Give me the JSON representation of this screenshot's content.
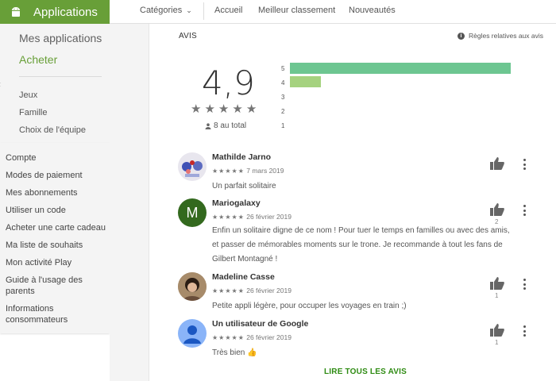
{
  "sidebar": {
    "app_title": "Applications",
    "my_apps": "Mes applications",
    "buy": "Acheter",
    "categories": [
      "Jeux",
      "Famille",
      "Choix de l'équipe"
    ],
    "account_links": [
      "Compte",
      "Modes de paiement",
      "Mes abonnements",
      "Utiliser un code",
      "Acheter une carte cadeau",
      "Ma liste de souhaits",
      "Mon activité Play",
      "Guide à l'usage des parents",
      "Informations consommateurs"
    ]
  },
  "topnav": {
    "categories": "Catégories",
    "home": "Accueil",
    "top": "Meilleur classement",
    "new": "Nouveautés"
  },
  "reviews_section": {
    "title": "AVIS",
    "rules": "Règles relatives aux avis",
    "score": "4,9",
    "total": "8 au total",
    "histogram": [
      {
        "label": "5",
        "fraction": 1.0,
        "color": "#6dc691"
      },
      {
        "label": "4",
        "fraction": 0.14,
        "color": "#a5d27f"
      },
      {
        "label": "3",
        "fraction": 0
      },
      {
        "label": "2",
        "fraction": 0
      },
      {
        "label": "1",
        "fraction": 0
      }
    ],
    "read_all": "LIRE TOUS LES AVIS"
  },
  "reviews": [
    {
      "name": "Mathilde Jarno",
      "date": "7 mars 2019",
      "text": "Un parfait solitaire",
      "likes": "",
      "avatar": "flowers"
    },
    {
      "name": "Mariogalaxy",
      "date": "26 février 2019",
      "text": "Enfin un solitaire digne de ce nom ! Pour tuer le temps en familles ou avec des amis, et passer de mémorables moments sur le trone. Je recommande à tout les fans de Gilbert Montagné !",
      "likes": "2",
      "avatar": "M",
      "avatar_color": "#33691e"
    },
    {
      "name": "Madeline Casse",
      "date": "26 février 2019",
      "text": "Petite appli légère, pour occuper les voyages en train ;)",
      "likes": "1",
      "avatar": "photo"
    },
    {
      "name": "Un utilisateur de Google",
      "date": "26 février 2019",
      "text": "Très bien 👍",
      "likes": "1",
      "avatar": "default",
      "avatar_color": "#8ab4f8"
    }
  ]
}
